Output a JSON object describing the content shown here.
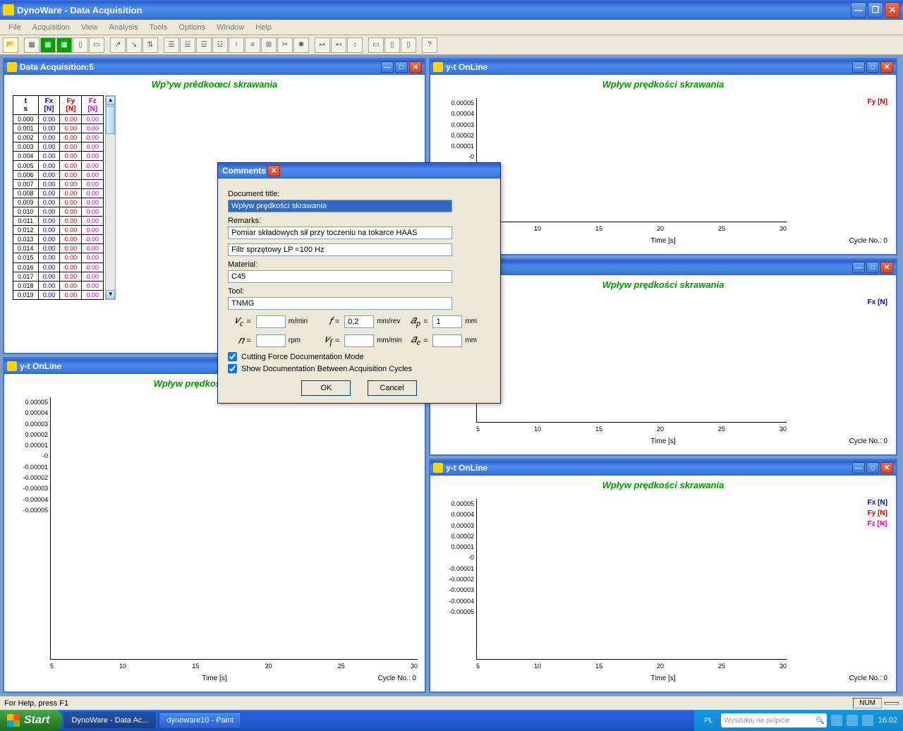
{
  "app": {
    "title": "DynoWare - Data Acquisition"
  },
  "menus": [
    "File",
    "Acquisition",
    "View",
    "Analysis",
    "Tools",
    "Options",
    "Window",
    "Help"
  ],
  "win1": {
    "title": "Data Acquisition:5",
    "chart_title": "Wp³yw prêdkoœci skrawania",
    "headers": {
      "t": "t",
      "ts": "s",
      "fx": "Fx",
      "fxu": "[N]",
      "fy": "Fy",
      "fyu": "[N]",
      "fz": "Fz",
      "fzu": "[N]"
    },
    "rows": [
      [
        "0.000",
        "0.00",
        "0.00",
        "0.00"
      ],
      [
        "0.001",
        "0.00",
        "0.00",
        "0.00"
      ],
      [
        "0.002",
        "0.00",
        "0.00",
        "0.00"
      ],
      [
        "0.003",
        "0.00",
        "0.00",
        "0.00"
      ],
      [
        "0.004",
        "0.00",
        "0.00",
        "0.00"
      ],
      [
        "0.005",
        "0.00",
        "0.00",
        "0.00"
      ],
      [
        "0.006",
        "0.00",
        "0.00",
        "0.00"
      ],
      [
        "0.007",
        "0.00",
        "0.00",
        "0.00"
      ],
      [
        "0.008",
        "0.00",
        "0.00",
        "0.00"
      ],
      [
        "0.009",
        "0.00",
        "0.00",
        "0.00"
      ],
      [
        "0.010",
        "0.00",
        "0.00",
        "0.00"
      ],
      [
        "0.011",
        "0.00",
        "0.00",
        "0.00"
      ],
      [
        "0.012",
        "0.00",
        "0.00",
        "0.00"
      ],
      [
        "0.013",
        "0.00",
        "0.00",
        "0.00"
      ],
      [
        "0.014",
        "0.00",
        "0.00",
        "0.00"
      ],
      [
        "0.015",
        "0.00",
        "0.00",
        "0.00"
      ],
      [
        "0.016",
        "0.00",
        "0.00",
        "0.00"
      ],
      [
        "0.017",
        "0.00",
        "0.00",
        "0.00"
      ],
      [
        "0.018",
        "0.00",
        "0.00",
        "0.00"
      ],
      [
        "0.019",
        "0.00",
        "0.00",
        "0.00"
      ]
    ]
  },
  "yt_title": "y-t OnLine",
  "chart2_title": "Wpływ prędkości skrawania",
  "chart3_title": "Wpływ prędkości skrawania",
  "chart4_title": "Wpływ prędkości skrawania",
  "chart5_title": "Wpływ prędkości skrawania",
  "xlabel": "Time [s]",
  "cycle": "Cycle No.: 0",
  "xticks": [
    "5",
    "10",
    "15",
    "20",
    "25",
    "30"
  ],
  "legend": {
    "fx": "Fx [N]",
    "fy": "Fy [N]",
    "fz": "Fz [N]"
  },
  "yt_ticks_pos": [
    "0.00005",
    "0.00004",
    "0.00003",
    "0.00002",
    "0.00001",
    "-0"
  ],
  "yt_ticks_sym": [
    "0.00005",
    "0.00004",
    "0.00003",
    "0.00002",
    "0.00001",
    "-0",
    "-0.00001",
    "-0.00002",
    "-0.00003",
    "-0.00004",
    "-0.00005"
  ],
  "modal": {
    "title": "Comments",
    "l_doc": "Document title:",
    "v_doc": "Wpływ prędkości skrawania",
    "l_rem": "Remarks:",
    "v_rem": "Pomiar składowych sił przy toczeniu na tokarce HAAS",
    "v_rem2": "Filtr sprzętowy LP =100 Hz",
    "l_mat": "Material:",
    "v_mat": "C45",
    "l_tool": "Tool:",
    "v_tool": "TNMG",
    "sym_vc": "v_c",
    "u_vc": "m/min",
    "sym_f": "f",
    "v_f": "0,2",
    "u_f": "mm/rev",
    "sym_ap": "a_p",
    "v_ap": "1",
    "u_ap": "mm",
    "sym_n": "n",
    "u_n": "rpm",
    "sym_vf": "v_f",
    "u_vf2": "mm/min",
    "sym_ae": "a_e",
    "u_ae": "mm",
    "cb1": "Cutting Force Documentation Mode",
    "cb2": "Show Documentation Between Acquisition Cycles",
    "ok": "OK",
    "cancel": "Cancel"
  },
  "status": {
    "help": "For Help, press F1",
    "num": "NUM"
  },
  "taskbar": {
    "start": "Start",
    "t1": "DynoWare - Data Ac...",
    "t2": "dynoware10 - Paint",
    "lang": "PL",
    "search": "Wyszukaj na pulpicie",
    "clock": "16:02"
  }
}
